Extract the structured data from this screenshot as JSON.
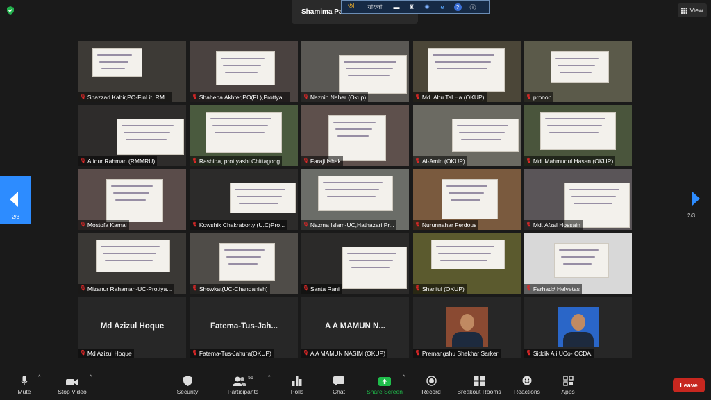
{
  "top": {
    "speaker_label": "Shamima Parv",
    "view_label": "View",
    "language_bar": {
      "language": "বাংলা"
    }
  },
  "pagination": {
    "left": "2/3",
    "right": "2/3"
  },
  "participants": [
    {
      "name": "Shazzad Kabir,PO-FinLit, RM..."
    },
    {
      "name": "Shahena Akhter,PO(FL),Prottya..."
    },
    {
      "name": "Naznin Naher (Okup)"
    },
    {
      "name": "Md. Abu Tal Ha (OKUP)"
    },
    {
      "name": "pronob"
    },
    {
      "name": "Atiqur Rahman (RMMRU)"
    },
    {
      "name": "Rashida, prottyashi Chittagong"
    },
    {
      "name": "Faraji Ishak"
    },
    {
      "name": "Al-Amin (OKUP)"
    },
    {
      "name": "Md. Mahmudul Hasan (OKUP)"
    },
    {
      "name": "Mostofa Kamal"
    },
    {
      "name": "Kowshik Chakraborty (U.C)Pro..."
    },
    {
      "name": "Nazma Islam-UC,Hathazari,Pr..."
    },
    {
      "name": "Nurunnahar Ferdous"
    },
    {
      "name": "Md. Afzal Hossain"
    },
    {
      "name": "Mizanur Rahaman-UC-Prottya..."
    },
    {
      "name": "Showkat(UC-Chandanish)"
    },
    {
      "name": "Santa Rani"
    },
    {
      "name": "Shariful (OKUP)"
    },
    {
      "name": "Farhad# Helvetas"
    },
    {
      "name": "Md Azizul Hoque",
      "display": "Md Azizul Hoque"
    },
    {
      "name": "Fatema-Tus-Jahura(OKUP)",
      "display": "Fatema-Tus-Jah..."
    },
    {
      "name": "A A MAMUN NASIM (OKUP)",
      "display": "A A MAMUN N..."
    },
    {
      "name": "Premangshu Shekhar Sarker"
    },
    {
      "name": "Siddik Ali,UCo- CCDA."
    }
  ],
  "toolbar": {
    "mute": "Mute",
    "stop_video": "Stop Video",
    "security": "Security",
    "participants": "Participants",
    "participants_count": "56",
    "polls": "Polls",
    "chat": "Chat",
    "share_screen": "Share Screen",
    "record": "Record",
    "breakout_rooms": "Breakout Rooms",
    "reactions": "Reactions",
    "apps": "Apps",
    "leave": "Leave"
  },
  "colors": {
    "accent": "#2d8cff",
    "share": "#1fbd4b",
    "leave": "#c7271f",
    "muted": "#e02828"
  }
}
